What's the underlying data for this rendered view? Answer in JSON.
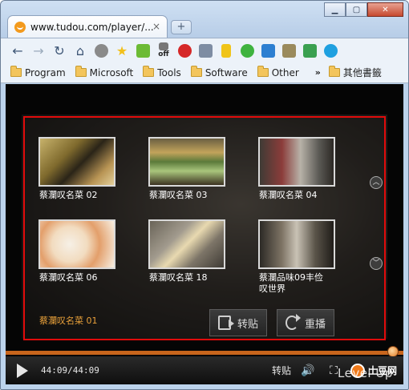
{
  "browser": {
    "tab_title": "www.tudou.com/player/...",
    "tab_close": "×",
    "new_tab": "+",
    "window_buttons": {
      "minimize": "▁",
      "maximize": "▢",
      "close": "✕"
    }
  },
  "toolbar": {
    "back": "←",
    "forward": "→",
    "reload": "↻",
    "home": "⌂",
    "star": "★",
    "extension_off_label": "off"
  },
  "bookmarks": {
    "items": [
      "Program",
      "Microsoft",
      "Tools",
      "Software",
      "Other"
    ],
    "more": "»",
    "other_bookmarks": "其他書籤"
  },
  "player": {
    "thumbnails": [
      {
        "label": "蔡瀾叹名菜 02"
      },
      {
        "label": "蔡瀾叹名菜 03"
      },
      {
        "label": "蔡瀾叹名菜 04"
      },
      {
        "label": "蔡瀾叹名菜 06"
      },
      {
        "label": "蔡瀾叹名菜 18"
      },
      {
        "label": "蔡瀾品味09丰俭\n叹世界"
      }
    ],
    "current_title": "蔡瀾叹名菜 01",
    "repost_label": "转贴",
    "replay_label": "重播",
    "time": "44:09/44:09",
    "controls_repost": "转贴",
    "brand": "土豆网",
    "side_up": "︿",
    "side_down": "﹀",
    "progress_fraction": 1.0
  },
  "watermark": "Level Up"
}
